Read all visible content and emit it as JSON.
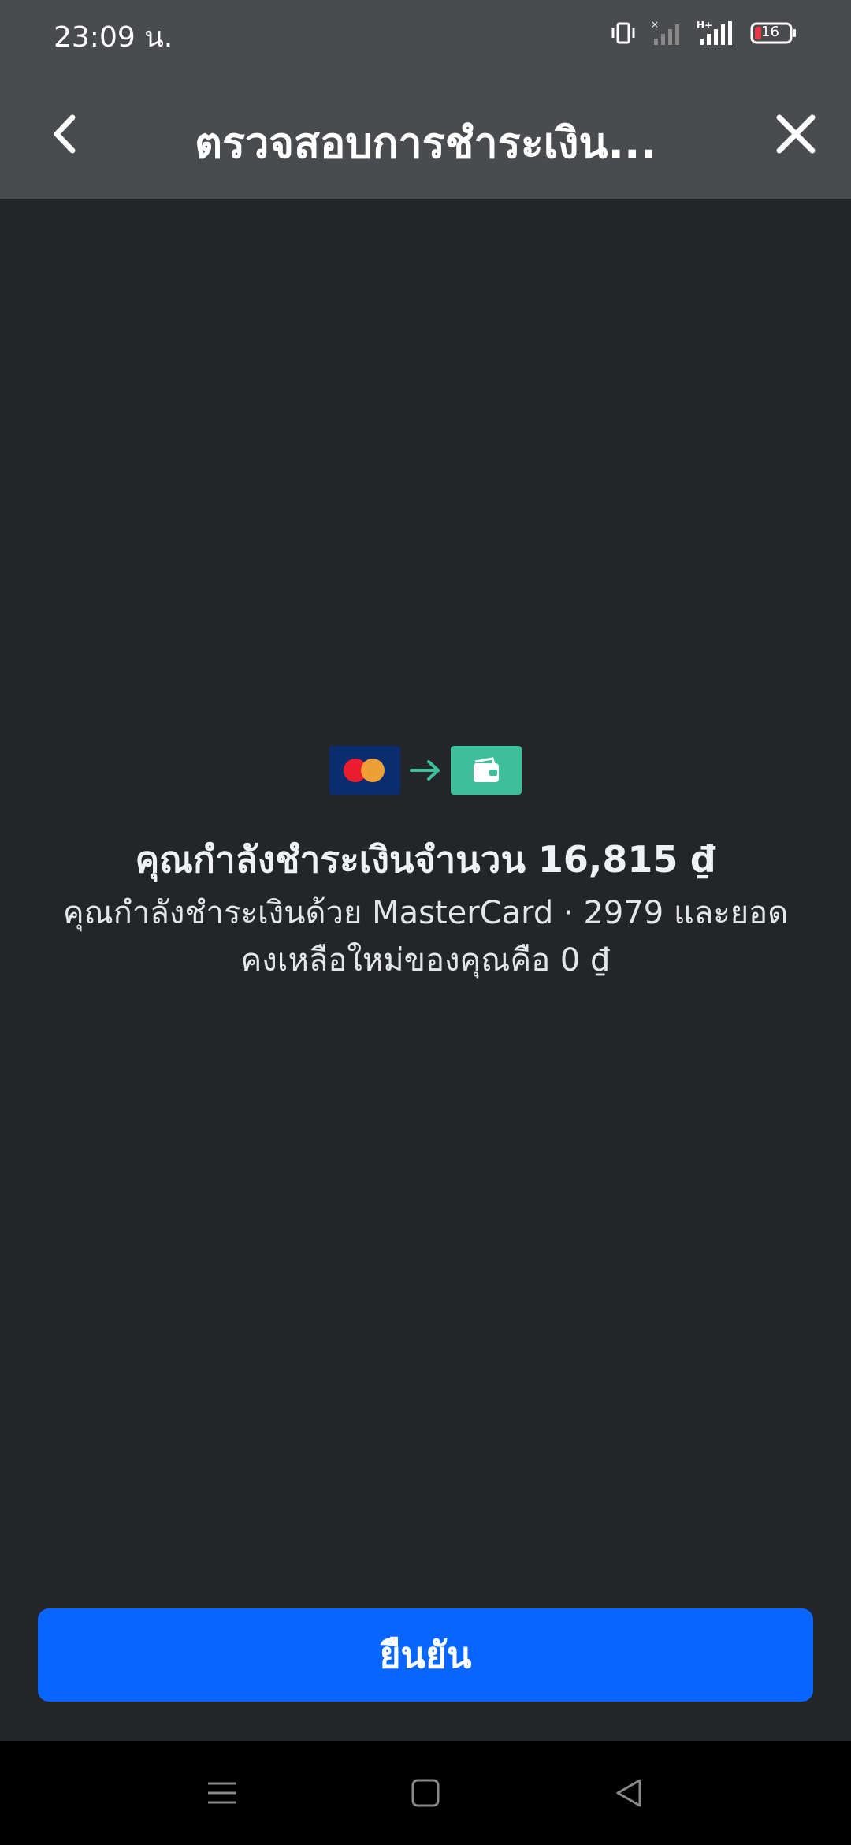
{
  "status_bar": {
    "time": "23:09 น.",
    "battery_level": "16",
    "network_label": "H+"
  },
  "app_bar": {
    "title": "ตรวจสอบการชำระเงิน..."
  },
  "payment": {
    "amount_line": "คุณกำลังชำระเงินจำนวน 16,815 ₫",
    "description_line1": "คุณกำลังชำระเงินด้วย MasterCard · 2979 และยอด",
    "description_line2": "คงเหลือใหม่ของคุณคือ 0 ₫"
  },
  "confirm_button": {
    "label": "ยืนยัน"
  },
  "colors": {
    "app_bar": "#4a4b4f",
    "background": "#242528",
    "accent_button": "#0866ff",
    "wallet": "#3dbf9b",
    "card": "#0b2c6e"
  },
  "icons": [
    "back-icon",
    "close-icon",
    "mastercard-icon",
    "arrow-right-icon",
    "wallet-icon",
    "vibrate-icon",
    "signal-icon",
    "battery-icon",
    "menu-icon",
    "home-icon",
    "back-triangle-icon"
  ]
}
